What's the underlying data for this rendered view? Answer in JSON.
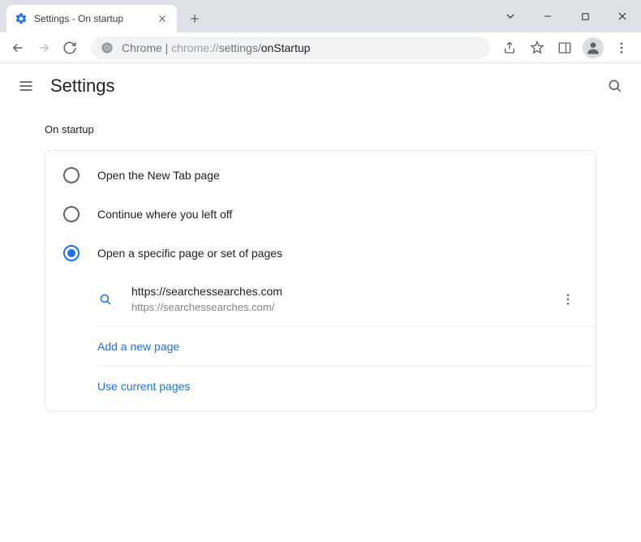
{
  "window": {
    "tab_title": "Settings - On startup"
  },
  "omnibox": {
    "scheme_label": "Chrome",
    "dim_prefix": "chrome://",
    "path": "settings/",
    "page": "onStartup"
  },
  "header": {
    "title": "Settings"
  },
  "section": {
    "title": "On startup"
  },
  "options": {
    "new_tab": "Open the New Tab page",
    "continue": "Continue where you left off",
    "specific": "Open a specific page or set of pages"
  },
  "pages": [
    {
      "title": "https://searchessearches.com",
      "url": "https://searchessearches.com/"
    }
  ],
  "actions": {
    "add_page": "Add a new page",
    "use_current": "Use current pages"
  }
}
